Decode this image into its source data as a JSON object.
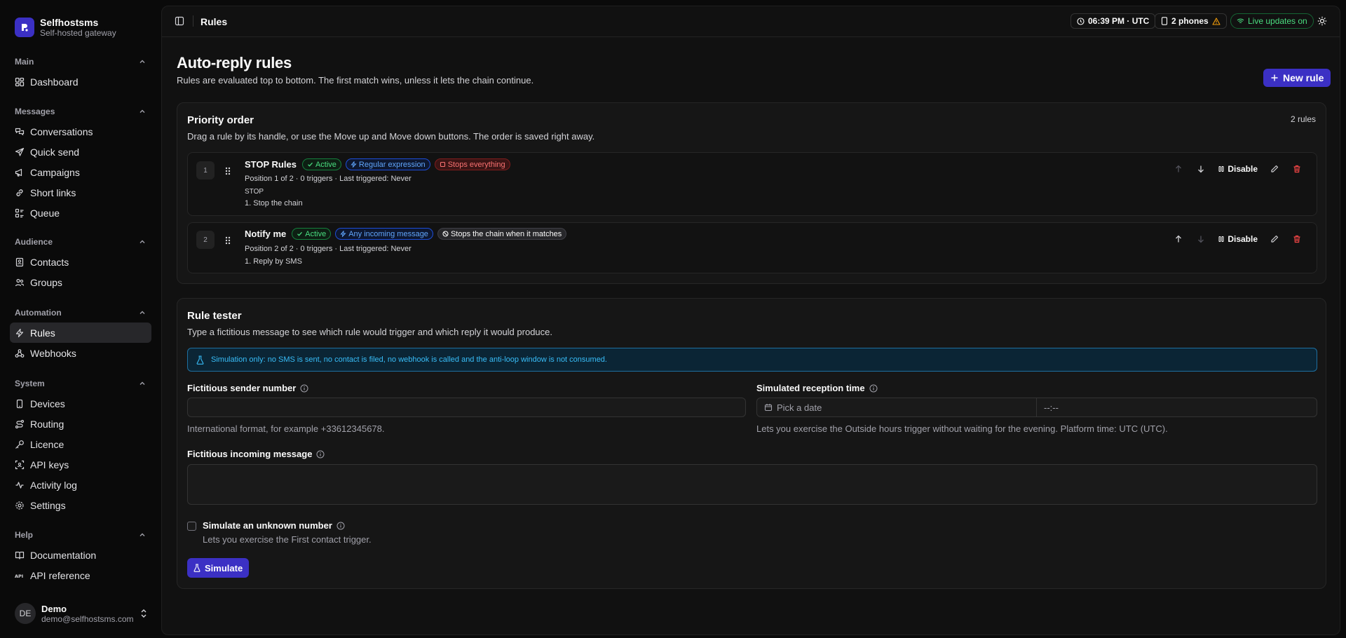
{
  "brand": {
    "name": "Selfhostsms",
    "subtitle": "Self-hosted gateway"
  },
  "nav": {
    "main": {
      "label": "Main",
      "items": [
        "Dashboard"
      ]
    },
    "messages": {
      "label": "Messages",
      "items": [
        "Conversations",
        "Quick send",
        "Campaigns",
        "Short links",
        "Queue"
      ]
    },
    "audience": {
      "label": "Audience",
      "items": [
        "Contacts",
        "Groups"
      ]
    },
    "automation": {
      "label": "Automation",
      "items": [
        "Rules",
        "Webhooks"
      ]
    },
    "system": {
      "label": "System",
      "items": [
        "Devices",
        "Routing",
        "Licence",
        "API keys",
        "Activity log",
        "Settings"
      ]
    },
    "help": {
      "label": "Help",
      "items": [
        "Documentation",
        "API reference"
      ]
    }
  },
  "user": {
    "initials": "DE",
    "name": "Demo",
    "email": "demo@selfhostsms.com"
  },
  "topbar": {
    "breadcrumb": "Rules",
    "time": "06:39 PM · UTC",
    "phones": "2 phones",
    "live": "Live updates on"
  },
  "page": {
    "title": "Auto-reply rules",
    "description": "Rules are evaluated top to bottom. The first match wins, unless it lets the chain continue.",
    "new_rule_label": "New rule"
  },
  "priority": {
    "title": "Priority order",
    "description": "Drag a rule by its handle, or use the Move up and Move down buttons. The order is saved right away.",
    "count": "2 rules",
    "rules": [
      {
        "position": "1",
        "name": "STOP Rules",
        "badges": {
          "status": "Active",
          "trigger": "Regular expression",
          "chain": "Stops everything"
        },
        "meta": "Position 1 of 2 · 0 triggers · Last triggered: Never",
        "pattern": "STOP",
        "action": "1. Stop the chain",
        "disable_label": "Disable"
      },
      {
        "position": "2",
        "name": "Notify me",
        "badges": {
          "status": "Active",
          "trigger": "Any incoming message",
          "chain": "Stops the chain when it matches"
        },
        "meta": "Position 2 of 2 · 0 triggers · Last triggered: Never",
        "action": "1. Reply by SMS",
        "disable_label": "Disable"
      }
    ]
  },
  "tester": {
    "title": "Rule tester",
    "description": "Type a fictitious message to see which rule would trigger and which reply it would produce.",
    "notice": "Simulation only: no SMS is sent, no contact is filed, no webhook is called and the anti-loop window is not consumed.",
    "sender_label": "Fictitious sender number",
    "sender_value": "",
    "sender_hint": "International format, for example +33612345678.",
    "reception_label": "Simulated reception time",
    "date_placeholder": "Pick a date",
    "time_placeholder": "--:--",
    "reception_hint": "Lets you exercise the Outside hours trigger without waiting for the evening. Platform time: UTC (UTC).",
    "message_label": "Fictitious incoming message",
    "message_value": "",
    "unknown_label": "Simulate an unknown number",
    "unknown_hint": "Lets you exercise the First contact trigger.",
    "simulate_label": "Simulate"
  },
  "colors": {
    "accent": "#3b30c4",
    "success": "#4ade80",
    "info": "#60a5fa",
    "danger": "#ef4444"
  }
}
